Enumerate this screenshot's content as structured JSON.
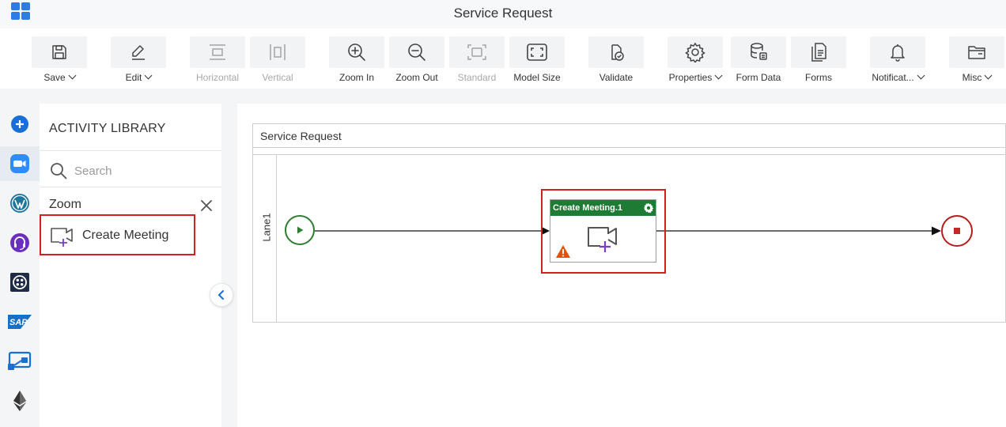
{
  "app": {
    "title": "Service Request"
  },
  "toolbar": {
    "save": "Save",
    "edit": "Edit",
    "horizontal": "Horizontal",
    "vertical": "Vertical",
    "zoom_in": "Zoom In",
    "zoom_out": "Zoom Out",
    "standard": "Standard",
    "model_size": "Model Size",
    "validate": "Validate",
    "properties": "Properties",
    "form_data": "Form Data",
    "forms": "Forms",
    "notifications": "Notificat...",
    "misc": "Misc"
  },
  "rail": {
    "icons": [
      "add-icon",
      "zoom-icon",
      "wordpress-icon",
      "support-headset-icon",
      "twilio-icon",
      "sap-icon",
      "power-automate-icon",
      "ethereum-icon"
    ],
    "sap_text": "SAP",
    "active": "zoom-icon"
  },
  "library": {
    "title": "ACTIVITY LIBRARY",
    "search_placeholder": "Search",
    "group": "Zoom",
    "items": [
      {
        "label": "Create Meeting"
      }
    ]
  },
  "canvas": {
    "pool_title": "Service Request",
    "lane_label": "Lane1",
    "task": {
      "title": "Create Meeting.1",
      "status": "warning"
    }
  },
  "colors": {
    "accent": "#2d7be5",
    "highlight_border": "#d21f1f",
    "task_header": "#1e7b34",
    "start_event": "#2e7d32",
    "end_event": "#b71c1c",
    "warning": "#e65100",
    "activity_icon_plus": "#7b3fc4"
  }
}
